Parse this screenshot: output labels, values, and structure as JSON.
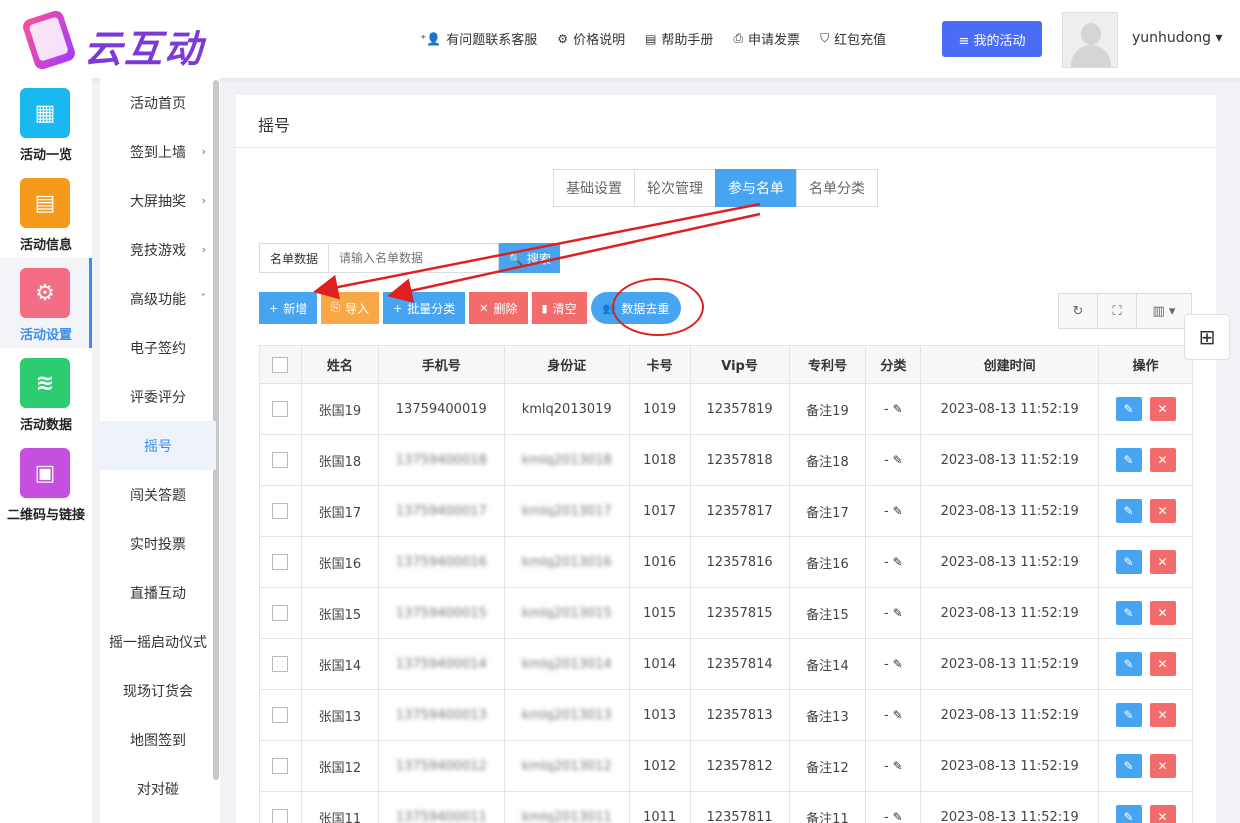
{
  "header": {
    "logo_text": "云互动",
    "nav": [
      {
        "icon": "user-plus-icon",
        "glyph": "⁺👤",
        "label": "有问题联系客服"
      },
      {
        "icon": "gear-icon",
        "glyph": "⚙",
        "label": "价格说明"
      },
      {
        "icon": "book-icon",
        "glyph": "▤",
        "label": "帮助手册"
      },
      {
        "icon": "printer-icon",
        "glyph": "⎙",
        "label": "申请发票"
      },
      {
        "icon": "shield-icon",
        "glyph": "⛉",
        "label": "红包充值"
      }
    ],
    "my_activity_label": "≡ 我的活动",
    "username": "yunhudong ▾"
  },
  "sidebar1": [
    {
      "label": "活动一览",
      "color": "#19b8f0",
      "glyph": "▦"
    },
    {
      "label": "活动信息",
      "color": "#f79a1b",
      "glyph": "▤"
    },
    {
      "label": "活动设置",
      "color": "#f36d84",
      "glyph": "⚙"
    },
    {
      "label": "活动数据",
      "color": "#2ecc71",
      "glyph": "≋"
    },
    {
      "label": "二维码与链接",
      "color": "#c74fe0",
      "glyph": "▣"
    }
  ],
  "sidebar2": [
    {
      "label": "活动首页",
      "chev": ""
    },
    {
      "label": "签到上墙",
      "chev": "›"
    },
    {
      "label": "大屏抽奖",
      "chev": "›"
    },
    {
      "label": "竞技游戏",
      "chev": "›"
    },
    {
      "label": "高级功能",
      "chev": "ˇ"
    },
    {
      "label": "电子签约",
      "chev": ""
    },
    {
      "label": "评委评分",
      "chev": ""
    },
    {
      "label": "摇号",
      "chev": ""
    },
    {
      "label": "闯关答题",
      "chev": ""
    },
    {
      "label": "实时投票",
      "chev": ""
    },
    {
      "label": "直播互动",
      "chev": ""
    },
    {
      "label": "摇一摇启动仪式",
      "chev": ""
    },
    {
      "label": "现场订货会",
      "chev": ""
    },
    {
      "label": "地图签到",
      "chev": ""
    },
    {
      "label": "对对碰",
      "chev": ""
    }
  ],
  "main": {
    "title": "摇号",
    "tabs": [
      "基础设置",
      "轮次管理",
      "参与名单",
      "名单分类"
    ],
    "search": {
      "label": "名单数据",
      "placeholder": "请输入名单数据",
      "button": "🔍 搜索"
    },
    "actions": [
      {
        "label": "新增",
        "glyph": "+",
        "cls": "b-blue",
        "name": "add-button"
      },
      {
        "label": "导入",
        "glyph": "⎘",
        "cls": "b-orange",
        "name": "import-button"
      },
      {
        "label": "批量分类",
        "glyph": "+",
        "cls": "b-blue",
        "name": "batch-classify-button"
      },
      {
        "label": "删除",
        "glyph": "✕",
        "cls": "b-red",
        "name": "delete-button"
      },
      {
        "label": "清空",
        "glyph": "▮",
        "cls": "b-red",
        "name": "clear-button"
      },
      {
        "label": "数据去重",
        "glyph": "👥",
        "cls": "b-blue",
        "name": "dedupe-button"
      }
    ],
    "tools": [
      "↻",
      "⛶",
      "▥ ▾"
    ],
    "qr_glyph": "⊞"
  },
  "table": {
    "headers": [
      "",
      "姓名",
      "手机号",
      "身份证",
      "卡号",
      "Vip号",
      "专利号",
      "分类",
      "创建时间",
      "操作"
    ],
    "rows": [
      {
        "name": "张国19",
        "phone": "13759400019",
        "id": "kmlq2013019",
        "card": "1019",
        "vip": "12357819",
        "patent": "备注19",
        "cat": "-",
        "time": "2023-08-13 11:52:19"
      },
      {
        "name": "张国18",
        "phone": "13759400018",
        "id": "kmlq2013018",
        "card": "1018",
        "vip": "12357818",
        "patent": "备注18",
        "cat": "-",
        "time": "2023-08-13 11:52:19"
      },
      {
        "name": "张国17",
        "phone": "13759400017",
        "id": "kmlq2013017",
        "card": "1017",
        "vip": "12357817",
        "patent": "备注17",
        "cat": "-",
        "time": "2023-08-13 11:52:19"
      },
      {
        "name": "张国16",
        "phone": "13759400016",
        "id": "kmlq2013016",
        "card": "1016",
        "vip": "12357816",
        "patent": "备注16",
        "cat": "-",
        "time": "2023-08-13 11:52:19"
      },
      {
        "name": "张国15",
        "phone": "13759400015",
        "id": "kmlq2013015",
        "card": "1015",
        "vip": "12357815",
        "patent": "备注15",
        "cat": "-",
        "time": "2023-08-13 11:52:19"
      },
      {
        "name": "张国14",
        "phone": "13759400014",
        "id": "kmlq2013014",
        "card": "1014",
        "vip": "12357814",
        "patent": "备注14",
        "cat": "-",
        "time": "2023-08-13 11:52:19"
      },
      {
        "name": "张国13",
        "phone": "13759400013",
        "id": "kmlq2013013",
        "card": "1013",
        "vip": "12357813",
        "patent": "备注13",
        "cat": "-",
        "time": "2023-08-13 11:52:19"
      },
      {
        "name": "张国12",
        "phone": "13759400012",
        "id": "kmlq2013012",
        "card": "1012",
        "vip": "12357812",
        "patent": "备注12",
        "cat": "-",
        "time": "2023-08-13 11:52:19"
      },
      {
        "name": "张国11",
        "phone": "13759400011",
        "id": "kmlq2013011",
        "card": "1011",
        "vip": "12357811",
        "patent": "备注11",
        "cat": "-",
        "time": "2023-08-13 11:52:19"
      }
    ],
    "edit_glyph": "✎",
    "delete_glyph": "✕"
  },
  "colors": {
    "accent": "#47a4f0",
    "brand": "#4a6cf7",
    "annotation": "#e02020"
  }
}
